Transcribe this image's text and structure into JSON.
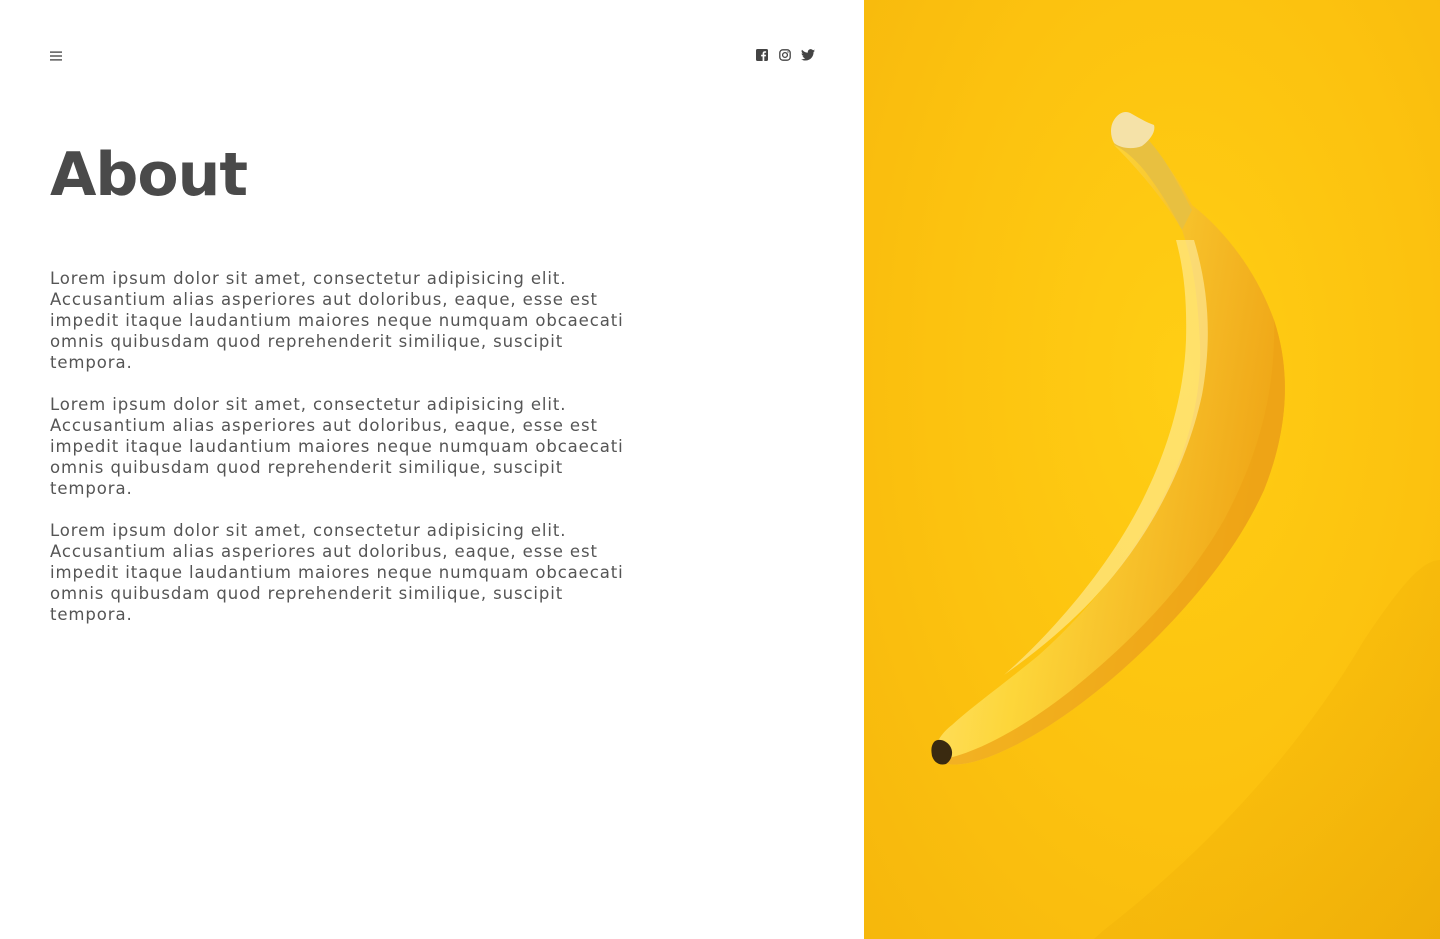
{
  "header": {
    "menu_icon": "hamburger-menu-icon",
    "social": [
      {
        "name": "facebook",
        "icon": "facebook-icon"
      },
      {
        "name": "instagram",
        "icon": "instagram-icon"
      },
      {
        "name": "twitter",
        "icon": "twitter-icon"
      }
    ]
  },
  "page": {
    "title": "About",
    "paragraphs": [
      "Lorem ipsum dolor sit amet, consectetur adipisicing elit. Accusantium alias asperiores aut doloribus, eaque, esse est impedit itaque laudantium maiores neque numquam obcaecati omnis quibusdam quod reprehenderit similique, suscipit tempora.",
      "Lorem ipsum dolor sit amet, consectetur adipisicing elit. Accusantium alias asperiores aut doloribus, eaque, esse est impedit itaque laudantium maiores neque numquam obcaecati omnis quibusdam quod reprehenderit similique, suscipit tempora.",
      "Lorem ipsum dolor sit amet, consectetur adipisicing elit. Accusantium alias asperiores aut doloribus, eaque, esse est impedit itaque laudantium maiores neque numquam obcaecati omnis quibusdam quod reprehenderit similique, suscipit tempora."
    ]
  },
  "hero_image": {
    "subject": "banana",
    "background_color": "#fcc20f"
  },
  "colors": {
    "text": "#555555",
    "title": "#4a4a4a",
    "accent": "#fcc20f"
  }
}
